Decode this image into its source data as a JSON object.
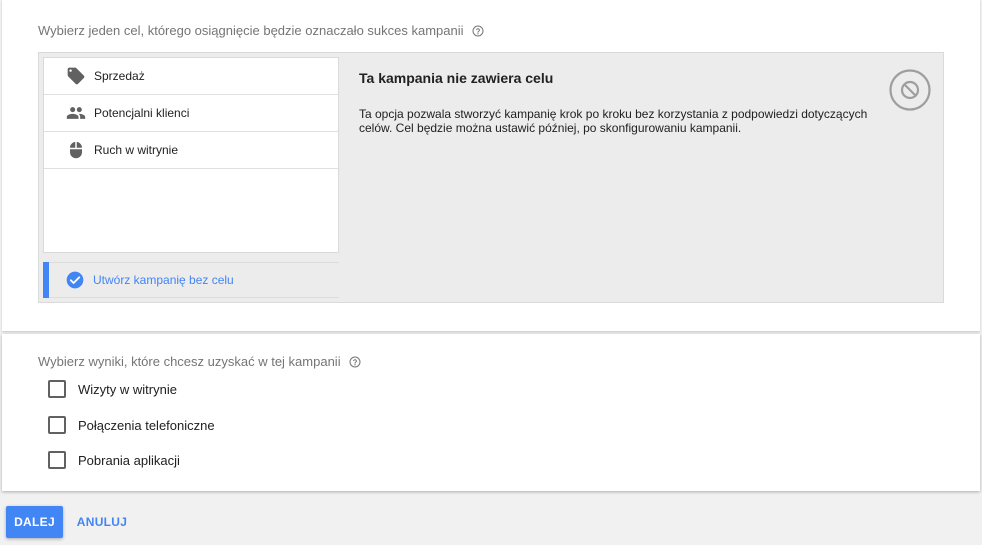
{
  "goal_section": {
    "title": "Wybierz jeden cel, którego osiągnięcie będzie oznaczało sukces kampanii",
    "goals": [
      {
        "label": "Sprzedaż",
        "icon": "tag-icon"
      },
      {
        "label": "Potencjalni klienci",
        "icon": "people-icon"
      },
      {
        "label": "Ruch w witrynie",
        "icon": "mouse-icon"
      }
    ],
    "no_goal_label": "Utwórz kampanię bez celu",
    "detail": {
      "title": "Ta kampania nie zawiera celu",
      "description": "Ta opcja pozwala stworzyć kampanię krok po kroku bez korzystania z podpowiedzi dotyczących celów. Cel będzie można ustawić później, po skonfigurowaniu kampanii."
    }
  },
  "results_section": {
    "title": "Wybierz wyniki, które chcesz uzyskać w tej kampanii",
    "options": [
      {
        "label": "Wizyty w witrynie",
        "checked": false
      },
      {
        "label": "Połączenia telefoniczne",
        "checked": false
      },
      {
        "label": "Pobrania aplikacji",
        "checked": false
      }
    ]
  },
  "actions": {
    "next_label": "DALEJ",
    "cancel_label": "ANULUJ"
  },
  "colors": {
    "accent": "#4285f4",
    "panel_bg": "#ececec"
  }
}
